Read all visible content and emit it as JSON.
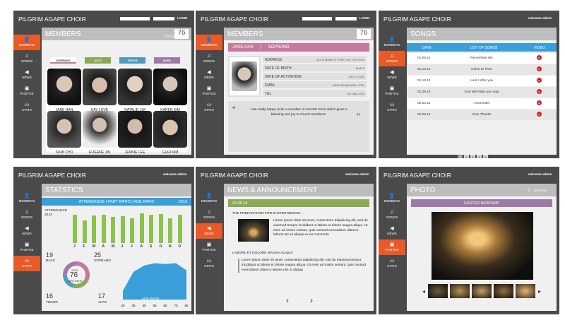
{
  "colors": {
    "accent": "#e85a26",
    "dark": "#4a4a4a",
    "soprano": "#c8799b",
    "alto": "#8aab56",
    "tenor": "#4f9bc0",
    "bass": "#9c7ba8",
    "green": "#8bc34a",
    "blue": "#3a9fd9"
  },
  "brand": "PILGRIM AGAPE CHOIR",
  "login": "LOGIN",
  "welcome": "welcome admin",
  "nav": {
    "members": "MEMBERS",
    "songs": "SONGS",
    "news": "NEWS",
    "photos": "PHOTOS",
    "stats": "STATS"
  },
  "members": {
    "title": "MEMBERS",
    "total_label": "TOTAL",
    "total": "76",
    "tabs": [
      "SOPRANO",
      "ALTO",
      "TENOR",
      "BASS"
    ],
    "people": [
      "JANE HAN",
      "KAY LOVE",
      "NATALIE LIM",
      "KAREN KIM",
      "SUMI CHO",
      "EUGENE JIN",
      "JENNIE LEE",
      "GURI KIM"
    ]
  },
  "detail": {
    "title": "MEMBERS",
    "total": "76",
    "name": "JANE HAN",
    "sep": "|",
    "part": "SOPRANO",
    "rows": [
      {
        "label": "ADDRESS",
        "value": "124 N MAIN ST FORT LEE, NJ 07043"
      },
      {
        "label": "DATE OF BIRTH",
        "value": "MAR 9"
      },
      {
        "label": "DATE OF ACTIVATION",
        "value": "JULY 3 2011"
      },
      {
        "label": "EMAIL",
        "value": "JANEHAN@GMAIL.COM"
      },
      {
        "label": "TEL",
        "value": "201-368-1234"
      }
    ],
    "quote": "I am really happy to be a member of AGAPE Choir which gives a blessing and joy to church members.",
    "quote_open": "“",
    "quote_close": "”"
  },
  "songs": {
    "title": "SONGS",
    "cols": {
      "date": "DATE",
      "list": "LIST OF SONGS",
      "video": "VIDEO"
    },
    "rows": [
      {
        "date": "01.05.14",
        "song": "Remember Me"
      },
      {
        "date": "01.12.14",
        "song": "Close to Thee"
      },
      {
        "date": "01.19.14",
        "song": "Lord I offer you"
      },
      {
        "date": "01.26.14",
        "song": "God will make you way"
      },
      {
        "date": "02.02.14",
        "song": "I surrender"
      },
      {
        "date": "02.09.14",
        "song": "Give Thanks"
      }
    ],
    "pages": [
      "1",
      "2",
      "3",
      "4",
      "5"
    ],
    "next": "▸"
  },
  "stats": {
    "title": "STATSTICS",
    "subtitle": "ATTENDANCE | PART RATIO | AGE RATIO",
    "year": "2013",
    "attendance_label": "ATTENDANCE",
    "attendance_year": "2013",
    "bass_n": "19",
    "bass": "BASS",
    "soprano_n": "25",
    "soprano": "SOPRANO",
    "tenor_n": "16",
    "tenor": "TENOR",
    "alto_n": "17",
    "alto": "ALTO",
    "donut_year": "2013",
    "donut_total": "76",
    "donut_label": "PART RATIO",
    "age_label": "AGE RATIO"
  },
  "chart_data": [
    {
      "type": "bar",
      "title": "ATTENDANCE",
      "categories": [
        "J",
        "F",
        "M",
        "A",
        "M",
        "J",
        "J",
        "A",
        "S",
        "O",
        "N",
        "D"
      ],
      "values": [
        80,
        65,
        78,
        80,
        74,
        76,
        70,
        85,
        80,
        82,
        70,
        80
      ],
      "ylim": [
        0,
        100
      ]
    },
    {
      "type": "pie",
      "title": "PART RATIO",
      "categories": [
        "SOPRANO",
        "ALTO",
        "TENOR",
        "BASS"
      ],
      "values": [
        25,
        17,
        16,
        19
      ]
    },
    {
      "type": "area",
      "title": "AGE RATIO",
      "x": [
        20,
        30,
        40,
        50,
        60,
        70,
        80
      ],
      "values": [
        22,
        70,
        86,
        92,
        90,
        92,
        74
      ],
      "ylim": [
        0,
        100
      ]
    }
  ],
  "news": {
    "title": "NEWS & ANNOUNCEMENT",
    "date": "02.09.14",
    "headline": "THE PREPARATION FOR EASTER BEGINS...",
    "body1": "Lorem ipsum dolor sit amet, consectetur adipisicing elit, sed do eiusmod tempor incididunt ut labore et dolore magna aliqua. Ut enim ad minim veniam, quis nostrud exercitation ullamco laboris nisi ut aliquip ex ea commodo",
    "headline2": "LABORE ET DOLORE MAGNA ALIQUA",
    "body2": "Lorem ipsum dolor sit amet, consectetur adipisicing elit, sed do eiusmod tempor incididunt ut labore et dolore magna aliqua. Ut enim ad minim veniam, quis nostrud exercitation ullamco laboris nisi ut aliquip",
    "prev": "‹",
    "next": "›"
  },
  "photo": {
    "title": "PHOTO",
    "upload": "UPLOAD",
    "album": "EASTER WORSHIP",
    "prev": "◂",
    "next": "▸"
  }
}
